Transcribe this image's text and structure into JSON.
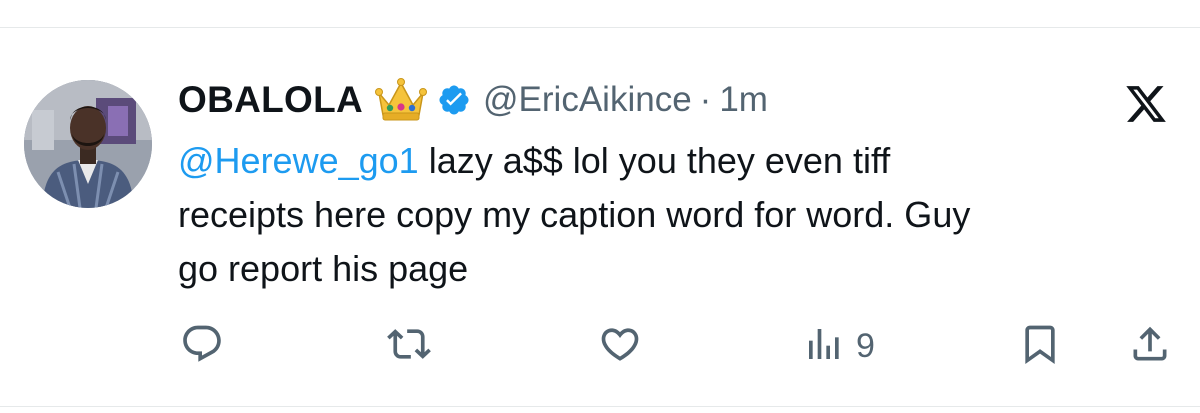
{
  "tweet": {
    "display_name": "OBALOLA",
    "badge_emoji": "crown-emoji",
    "verified": true,
    "handle": "@EricAikince",
    "separator": "·",
    "time": "1m",
    "mention": "@Herewe_go1",
    "body_line1": " lazy a$$ lol you they even tiff",
    "body_line2": "receipts here copy my caption word for word. Guy",
    "body_line3": "go report his page"
  },
  "actions": {
    "reply_icon": "reply-icon",
    "retweet_icon": "retweet-icon",
    "like_icon": "heart-icon",
    "views_icon": "views-bar-icon",
    "views_count": "9",
    "bookmark_icon": "bookmark-icon",
    "share_icon": "share-icon"
  },
  "brand": {
    "logo": "x-logo-icon"
  },
  "colors": {
    "text": "#0f1419",
    "secondary": "#536471",
    "link": "#1d9bf0",
    "verified": "#1d9bf0",
    "divider": "#e6e9ea"
  }
}
